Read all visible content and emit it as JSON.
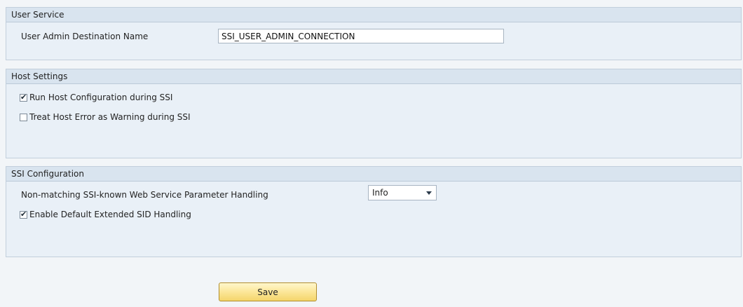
{
  "user_service": {
    "title": "User Service",
    "destination_label": "User Admin Destination Name",
    "destination_value": "SSI_USER_ADMIN_CONNECTION"
  },
  "host_settings": {
    "title": "Host Settings",
    "run_host_config": {
      "label": "Run Host Configuration during SSI",
      "checked": true
    },
    "treat_host_error": {
      "label": "Treat Host Error as Warning during SSI",
      "checked": false
    }
  },
  "ssi_configuration": {
    "title": "SSI Configuration",
    "param_handling_label": "Non-matching SSI-known Web Service Parameter Handling",
    "param_handling_value": "Info",
    "extended_sid": {
      "label": "Enable Default Extended SID Handling",
      "checked": true
    }
  },
  "actions": {
    "save_label": "Save"
  },
  "icons": {
    "checkmark": "check-icon",
    "dropdown": "chevron-down-icon"
  }
}
